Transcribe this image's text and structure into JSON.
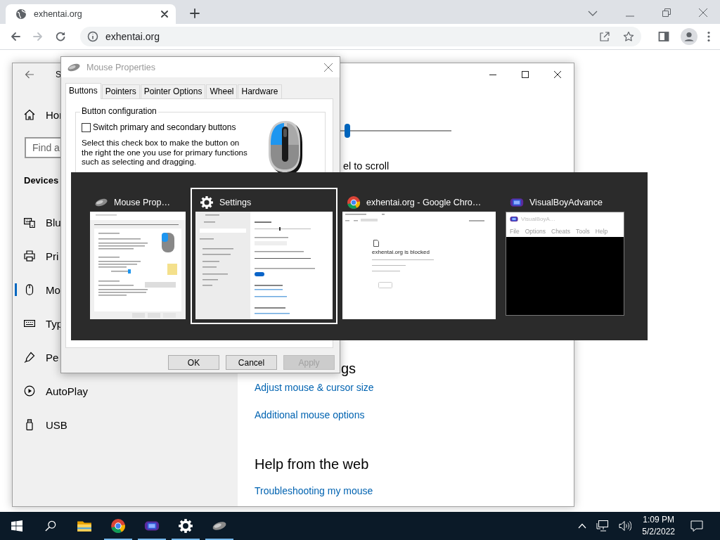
{
  "browser": {
    "tabs": [
      {
        "title": "exhentai.org",
        "selected": true
      }
    ],
    "forward": {
      "disabled": true
    },
    "address": "exhentai.org"
  },
  "settings_window": {
    "title": "S",
    "home": "Hor",
    "search_placeholder": "Find a",
    "section": "Devices",
    "nav_items": [
      {
        "kind": "bluetooth",
        "label": "Blu",
        "selected": false
      },
      {
        "kind": "printer",
        "label": "Pri",
        "selected": false
      },
      {
        "kind": "mouse",
        "label": "Mo",
        "selected": true
      },
      {
        "kind": "typing",
        "label": "Typ",
        "selected": false
      },
      {
        "kind": "pen",
        "label": "Pe",
        "selected": false
      },
      {
        "kind": "autoplay",
        "label": "AutoPlay",
        "selected": false
      },
      {
        "kind": "usb",
        "label": "USB",
        "selected": false
      }
    ],
    "slider": {
      "level": 0.47
    },
    "scroll_label": "el to scroll",
    "related_heading": "gs",
    "related_links": [
      "Adjust mouse & cursor size",
      "Additional mouse options"
    ],
    "help_heading": "Help from the web",
    "help_links": [
      "Troubleshooting my mouse"
    ]
  },
  "mouse_properties": {
    "title": "Mouse Properties",
    "tabs": [
      {
        "label": "Buttons",
        "selected": true
      },
      {
        "label": "Pointers",
        "selected": false
      },
      {
        "label": "Pointer Options",
        "selected": false
      },
      {
        "label": "Wheel",
        "selected": false
      },
      {
        "label": "Hardware",
        "selected": false
      }
    ],
    "group_title": "Button configuration",
    "checkbox": {
      "label": "Switch primary and secondary buttons",
      "checked": false
    },
    "description": "Select this check box to make the button on the right the one you use for primary functions such as selecting and dragging.",
    "buttons": [
      {
        "label": "OK",
        "disabled": false
      },
      {
        "label": "Cancel",
        "disabled": false
      },
      {
        "label": "Apply",
        "disabled": true
      }
    ]
  },
  "task_switcher": {
    "items": [
      {
        "kind": "mouse",
        "title": "Mouse Prop…",
        "selected": false
      },
      {
        "kind": "settings",
        "title": "Settings",
        "selected": true
      },
      {
        "kind": "browser",
        "title": "exhentai.org - Google Chro…",
        "selected": false,
        "preview_text": "exhentai.org is blocked"
      },
      {
        "kind": "emulator",
        "title": "VisualBoyAdvance",
        "selected": false,
        "preview_title": "VisualBoyA…",
        "preview_menu": [
          "File",
          "Options",
          "Cheats",
          "Tools",
          "Help"
        ]
      }
    ]
  },
  "taskbar": {
    "apps": [
      {
        "kind": "explorer",
        "open": false
      },
      {
        "kind": "chrome",
        "open": true
      },
      {
        "kind": "emulator",
        "open": true
      },
      {
        "kind": "settings",
        "open": true
      },
      {
        "kind": "mouse",
        "open": true
      }
    ],
    "time": "1:09 PM",
    "date": "5/2/2022"
  }
}
